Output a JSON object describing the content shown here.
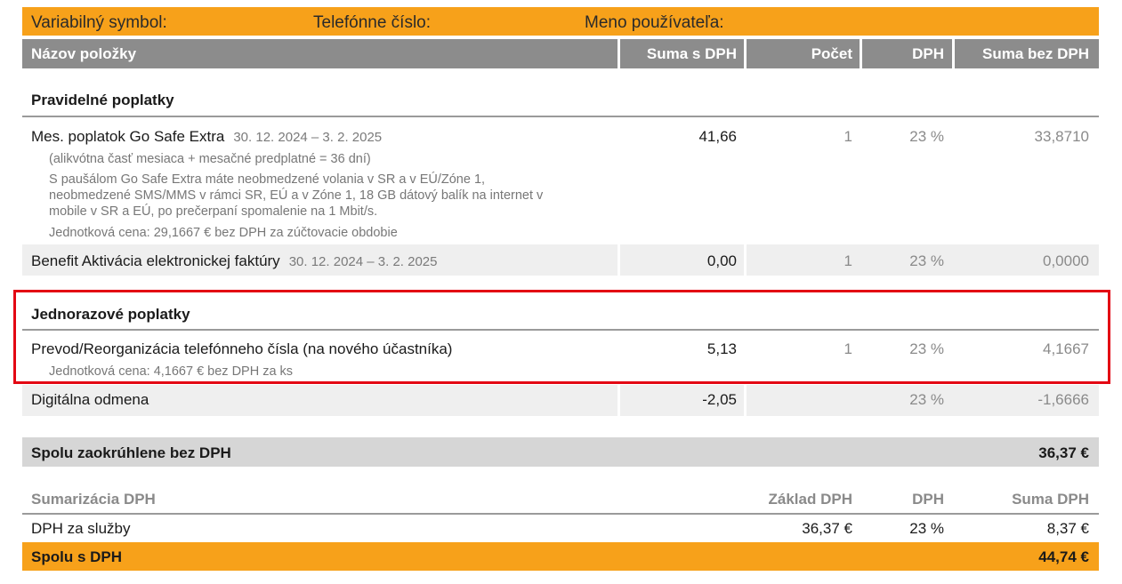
{
  "top": {
    "variable_symbol_label": "Variabilný symbol:",
    "phone_label": "Telefónne číslo:",
    "user_label": "Meno používateľa:",
    "bar_color": "#f7a11a"
  },
  "header": {
    "item_name": "Názov položky",
    "sum_with_vat": "Suma s DPH",
    "count": "Počet",
    "vat": "DPH",
    "sum_without_vat": "Suma bez DPH"
  },
  "regular": {
    "title": "Pravidelné poplatky",
    "items": [
      {
        "name": "Mes. poplatok Go Safe Extra",
        "period": "30. 12. 2024 – 3. 2. 2025",
        "sum_with_vat": "41,66",
        "count": "1",
        "vat": "23 %",
        "sum_without_vat": "33,8710",
        "notes": [
          "(alikvótna časť mesiaca + mesačné predplatné = 36 dní)",
          "S paušálom Go Safe Extra máte neobmedzené volania v SR a v EÚ/Zóne 1,",
          "neobmedzené SMS/MMS v rámci SR, EÚ a v Zóne 1, 18 GB dátový balík na internet v",
          "mobile v SR a EÚ, po prečerpaní spomalenie na 1 Mbit/s.",
          "Jednotková cena: 29,1667 € bez DPH za zúčtovacie obdobie"
        ]
      },
      {
        "name": "Benefit Aktivácia elektronickej faktúry",
        "period": "30. 12. 2024 – 3. 2. 2025",
        "sum_with_vat": "0,00",
        "count": "1",
        "vat": "23 %",
        "sum_without_vat": "0,0000"
      }
    ]
  },
  "onetime": {
    "title": "Jednorazové poplatky",
    "items": [
      {
        "name": "Prevod/Reorganizácia telefónneho čísla (na nového účastníka)",
        "sum_with_vat": "5,13",
        "count": "1",
        "vat": "23 %",
        "sum_without_vat": "4,1667",
        "note": "Jednotková cena: 4,1667 € bez DPH za ks"
      },
      {
        "name": "Digitálna odmena",
        "sum_with_vat": "-2,05",
        "vat": "23 %",
        "sum_without_vat": "-1,6666"
      }
    ],
    "highlight_color": "#e30613"
  },
  "total_rounded": {
    "label": "Spolu zaokrúhlene bez DPH",
    "value": "36,37 €"
  },
  "vat_summary": {
    "title": "Sumarizácia DPH",
    "col_base": "Základ DPH",
    "col_vat": "DPH",
    "col_sum": "Suma DPH",
    "row_label": "DPH za služby",
    "row_base": "36,37 €",
    "row_vat": "23 %",
    "row_sum": "8,37 €"
  },
  "total_with_vat": {
    "label": "Spolu s DPH",
    "value": "44,74 €"
  }
}
